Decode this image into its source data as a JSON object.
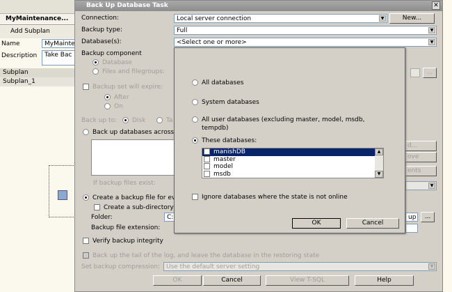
{
  "left_panel": {
    "tab": "MyMaintenance...",
    "add_subplan": "Add Subplan",
    "name_label": "Name",
    "name_value": "MyMainte",
    "description_label": "Description",
    "description_value": "Take Bac",
    "subplan_header": "Subplan",
    "subplans": [
      "Subplan_1"
    ]
  },
  "dialog": {
    "title": "Back Up Database Task",
    "connection_label": "Connection:",
    "connection_value": "Local server connection",
    "new_button": "New...",
    "backup_type_label": "Backup type:",
    "backup_type_value": "Full",
    "databases_label": "Database(s):",
    "databases_value": "<Select one or more>",
    "backup_component": "Backup component",
    "component_database": "Database",
    "component_files": "Files and filegroups:",
    "expire_label": "Backup set will expire:",
    "after": "After",
    "on": "On",
    "backup_to": "Back up to:",
    "disk": "Disk",
    "tape": "Ta",
    "across_label": "Back up databases across",
    "if_exist_label": "If backup files exist:",
    "create_file_label": "Create a backup file for ev",
    "subdir_label": "Create a sub-directory",
    "folder_label": "Folder:",
    "folder_value_left": "C:",
    "folder_value_right": "up",
    "browse": "...",
    "ext_label": "Backup file extension:",
    "verify_label": "Verify backup integrity",
    "tail_label": "Back up the tail of the log, and leave the database in the restoring state",
    "compression_label": "Set backup compression:",
    "compression_value": "Use the default server setting",
    "side_buttons": [
      "d...",
      "ove",
      "ents"
    ],
    "ok": "OK",
    "cancel": "Cancel",
    "view_tsql": "View T-SQL",
    "help": "Help"
  },
  "popup": {
    "all": "All databases",
    "system": "System databases",
    "user_line1": "All user databases  (excluding master, model, msdb,",
    "user_line2": "tempdb)",
    "these": "These databases:",
    "databases": [
      {
        "name": "manishDB",
        "checked": true
      },
      {
        "name": "master",
        "checked": false
      },
      {
        "name": "model",
        "checked": false
      },
      {
        "name": "msdb",
        "checked": false
      }
    ],
    "ignore": "Ignore databases where the state is not online",
    "ok": "OK",
    "cancel": "Cancel"
  }
}
